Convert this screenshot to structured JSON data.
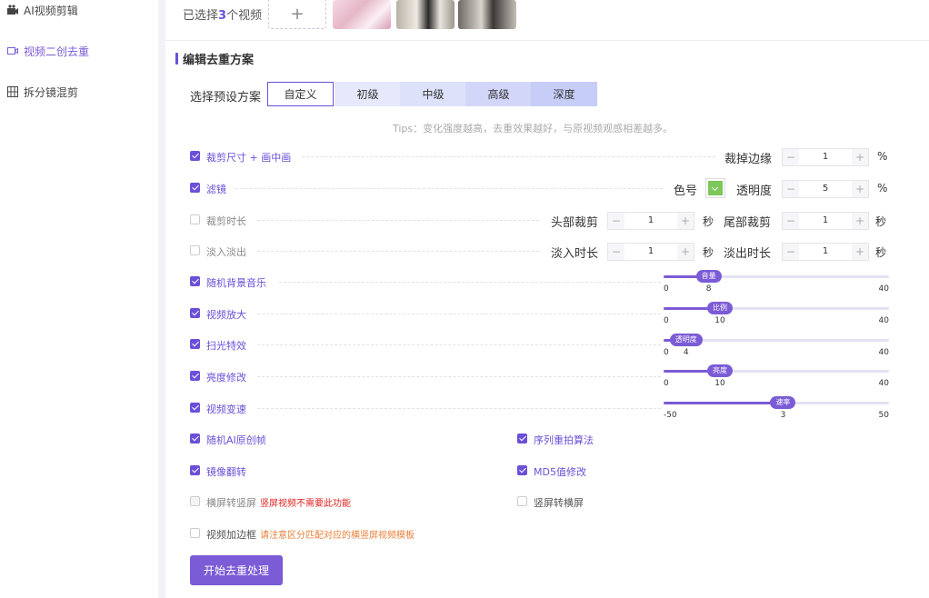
{
  "sidebar": {
    "items": [
      {
        "label": "AI视频剪辑",
        "icon": "camera-icon"
      },
      {
        "label": "视频二创去重",
        "icon": "video-icon"
      },
      {
        "label": "拆分镜混剪",
        "icon": "grid-icon"
      }
    ],
    "active_index": 1
  },
  "top": {
    "selected_prefix": "已选择",
    "selected_count": "3",
    "selected_suffix": "个视频",
    "add_label": "+"
  },
  "section_title": "编辑去重方案",
  "preset": {
    "label": "选择预设方案",
    "options": [
      "自定义",
      "初级",
      "中级",
      "高级",
      "深度"
    ],
    "selected": "自定义"
  },
  "tips": "Tips：变化强度越高，去重效果越好，与原视频观感相差越多。",
  "rows": {
    "crop_size": {
      "label": "裁剪尺寸 + 画中画",
      "checked": true,
      "field_label": "裁掉边缘",
      "value": "1",
      "unit": "%"
    },
    "filter": {
      "label": "滤镜",
      "checked": true,
      "color_label": "色号",
      "color": "#7cc85a",
      "field_label": "透明度",
      "value": "5",
      "unit": "%"
    },
    "trim": {
      "label": "裁剪时长",
      "checked": false,
      "head_label": "头部裁剪",
      "head_value": "1",
      "head_unit": "秒",
      "tail_label": "尾部裁剪",
      "tail_value": "1",
      "tail_unit": "秒"
    },
    "fade": {
      "label": "淡入淡出",
      "checked": false,
      "in_label": "淡入时长",
      "in_value": "1",
      "in_unit": "秒",
      "out_label": "淡出时长",
      "out_value": "1",
      "out_unit": "秒"
    }
  },
  "sliders": [
    {
      "label": "随机背景音乐",
      "checked": true,
      "handle": "音量",
      "min": "0",
      "max": "40",
      "value": "8"
    },
    {
      "label": "视频放大",
      "checked": true,
      "handle": "比例",
      "min": "0",
      "max": "40",
      "value": "10"
    },
    {
      "label": "扫光特效",
      "checked": true,
      "handle": "透明度",
      "min": "0",
      "max": "40",
      "value": "4"
    },
    {
      "label": "亮度修改",
      "checked": true,
      "handle": "亮度",
      "min": "0",
      "max": "40",
      "value": "10"
    },
    {
      "label": "视频变速",
      "checked": true,
      "handle": "速率",
      "min": "-50",
      "max": "50",
      "value": "3"
    }
  ],
  "options": {
    "random_ai_frame": {
      "label": "随机AI原创帧",
      "checked": true
    },
    "sequence_resample": {
      "label": "序列重拍算法",
      "checked": true
    },
    "mirror_flip": {
      "label": "镜像翻转",
      "checked": true
    },
    "md5_modify": {
      "label": "MD5值修改",
      "checked": true
    },
    "landscape_to_portrait": {
      "label": "横屏转竖屏",
      "checked": false,
      "note": "竖屏视频不需要此功能"
    },
    "portrait_to_landscape": {
      "label": "竖屏转横屏",
      "checked": false
    },
    "add_border": {
      "label": "视频加边框",
      "checked": false,
      "note": "请注意区分匹配对应的横竖屏视频模板"
    }
  },
  "start_button": "开始去重处理",
  "colors": {
    "accent": "#6b4fd8",
    "slider": "#7b5bd6"
  }
}
